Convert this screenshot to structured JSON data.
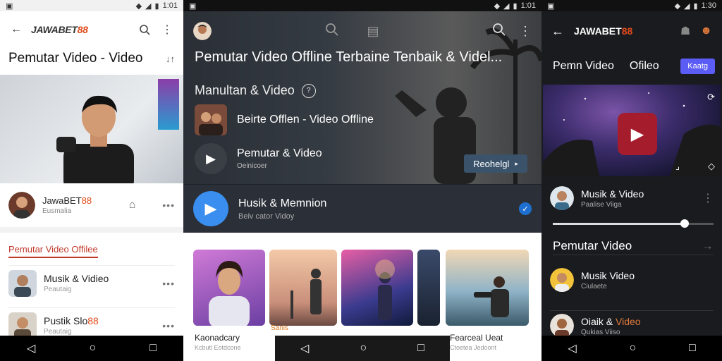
{
  "panel1": {
    "status": {
      "time": "1:01"
    },
    "brand": {
      "text": "JAWABET",
      "accent": "88"
    },
    "title": "Pemutar Video - Video",
    "channel": {
      "name_text": "JawaBET",
      "name_accent": "88",
      "subtitle": "Eusmalia"
    },
    "section_title": "Pemutar Video Offilee",
    "items": [
      {
        "title": "Musik & Vidieo",
        "subtitle": "Peautaig"
      },
      {
        "title_text": "Pustik Slo",
        "title_accent": "88",
        "subtitle": "Peautaig"
      }
    ]
  },
  "panel2": {
    "status": {
      "time": "1:01"
    },
    "title": "Pemutar Video Offline Terbaine Tenbaik & Videl...",
    "subtitle": "Manultan & Video",
    "row1": {
      "title": "Beirte Offlen - Video Offline"
    },
    "row2": {
      "title": "Pemutar & Video",
      "subtitle": "Oeinicoer"
    },
    "download_label": "Reohelgl",
    "music": {
      "title": "Husik & Memnion",
      "subtitle": "Beiv cator Vidoy"
    },
    "cards": [
      {
        "title": "Kaonadcary",
        "subtitle": "Kcbutl Eotdcone"
      },
      {
        "title": "Sanis",
        "subtitle": ""
      },
      {
        "title": "",
        "subtitle": ""
      },
      {
        "title": "",
        "subtitle": ""
      },
      {
        "title": "Fearceal Ueat",
        "subtitle": "Ctoetea Jedoont"
      }
    ]
  },
  "panel3": {
    "status": {
      "time": "1:30"
    },
    "brand": {
      "text": "JAWABET",
      "accent": "88"
    },
    "tabs": [
      "Pemn Video",
      "Ofileo"
    ],
    "tab_button": "Kaatg",
    "items": [
      {
        "title": "Musik & Video",
        "subtitle": "Paalise Viiga"
      },
      {
        "title": "Musik Video",
        "subtitle": "Ciulaete"
      },
      {
        "title_text": "Oiaik & ",
        "title_accent": "Video",
        "subtitle": "Qukias Viiso"
      }
    ],
    "section_title": "Pemutar Video",
    "slider_progress": 0.82,
    "accent_color": "#5b5bf5"
  }
}
